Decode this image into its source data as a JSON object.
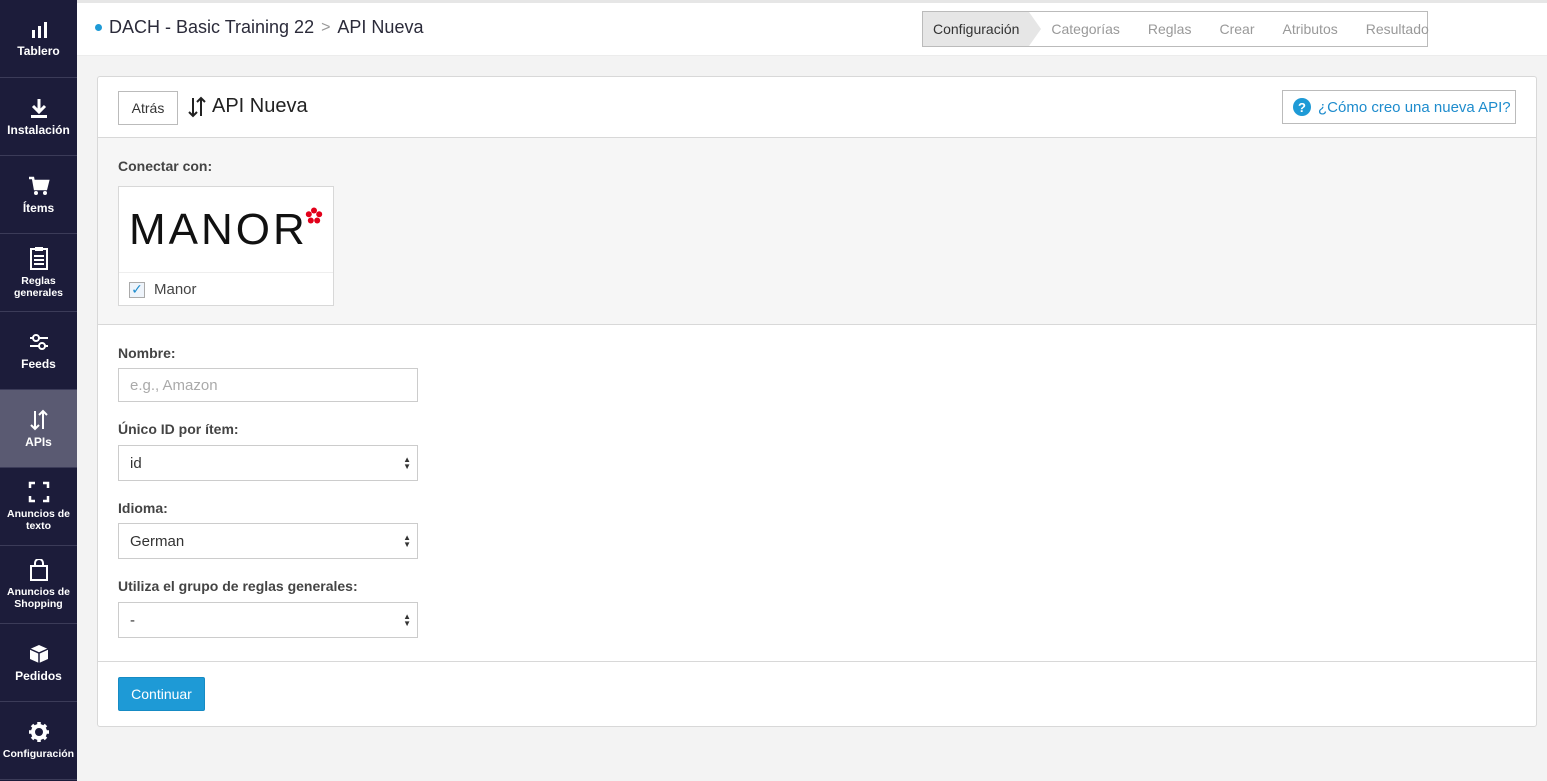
{
  "sidebar": {
    "items": [
      {
        "label": "Tablero",
        "icon": "bar-chart-icon"
      },
      {
        "label": "Instalación",
        "icon": "download-icon"
      },
      {
        "label": "Ítems",
        "icon": "cart-icon"
      },
      {
        "label": "Reglas generales",
        "icon": "clipboard-icon"
      },
      {
        "label": "Feeds",
        "icon": "sliders-icon"
      },
      {
        "label": "APIs",
        "icon": "arrows-updown-icon"
      },
      {
        "label": "Anuncios de texto",
        "icon": "frame-icon"
      },
      {
        "label": "Anuncios de Shopping",
        "icon": "bag-icon"
      },
      {
        "label": "Pedidos",
        "icon": "box-icon"
      },
      {
        "label": "Configuración",
        "icon": "gear-icon"
      }
    ],
    "active_index": 5
  },
  "breadcrumb": {
    "project": "DACH - Basic Training 22",
    "separator": ">",
    "current": "API Nueva"
  },
  "wizard": {
    "steps": [
      "Configuración",
      "Categorías",
      "Reglas",
      "Crear",
      "Atributos",
      "Resultado"
    ],
    "active_index": 0
  },
  "header": {
    "back_label": "Atrás",
    "title": "API Nueva",
    "help_label": "¿Cómo creo una nueva API?"
  },
  "connect": {
    "label": "Conectar con:",
    "partner": {
      "logo_text": "MANOR",
      "name": "Manor",
      "checked": true
    }
  },
  "form": {
    "name": {
      "label": "Nombre:",
      "placeholder": "e.g., Amazon",
      "value": ""
    },
    "unique_id": {
      "label": "Único ID por ítem:",
      "value": "id"
    },
    "language": {
      "label": "Idioma:",
      "value": "German"
    },
    "rule_group": {
      "label": "Utiliza el grupo de reglas generales:",
      "value": "-"
    }
  },
  "actions": {
    "continue_label": "Continuar"
  },
  "colors": {
    "sidebar_bg": "#1c1c3a",
    "sidebar_active": "#5a5a72",
    "accent": "#1e9ad6",
    "logo_flower": "#e2001a"
  }
}
